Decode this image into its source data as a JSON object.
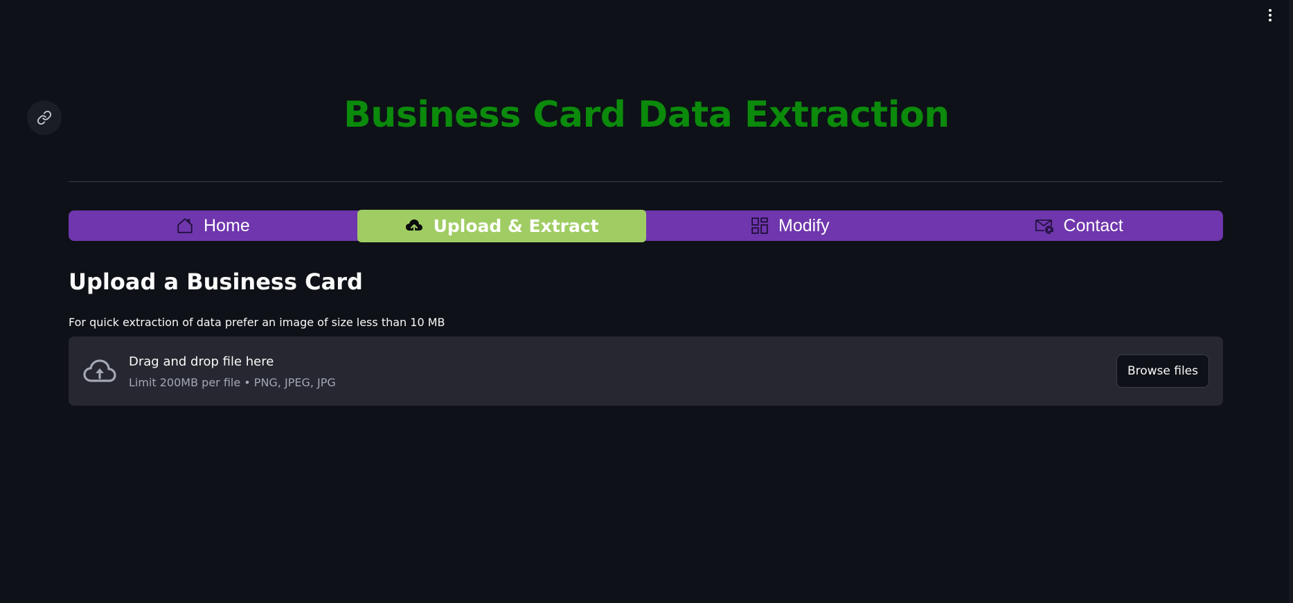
{
  "app": {
    "title": "Business Card Data Extraction",
    "title_color": "#0b8a0b",
    "background": "#0e1117"
  },
  "nav": {
    "bar_color": "#6f36ad",
    "active_color": "#a0cd63",
    "items": [
      {
        "label": "Home",
        "icon": "home-icon",
        "active": false
      },
      {
        "label": "Upload & Extract",
        "icon": "cloud-upload-icon",
        "active": true
      },
      {
        "label": "Modify",
        "icon": "dashboard-icon",
        "active": false
      },
      {
        "label": "Contact",
        "icon": "envelope-at-icon",
        "active": false
      }
    ]
  },
  "main": {
    "heading": "Upload a Business Card",
    "hint": "For quick extraction of data prefer an image of size less than 10 MB",
    "uploader": {
      "title": "Drag and drop file here",
      "subtitle": "Limit 200MB per file • PNG, JPEG, JPG",
      "button_label": "Browse files",
      "icon": "cloud-upload-icon"
    }
  },
  "icons": {
    "main_menu": "vertical-dots-icon",
    "anchor": "link-icon"
  }
}
